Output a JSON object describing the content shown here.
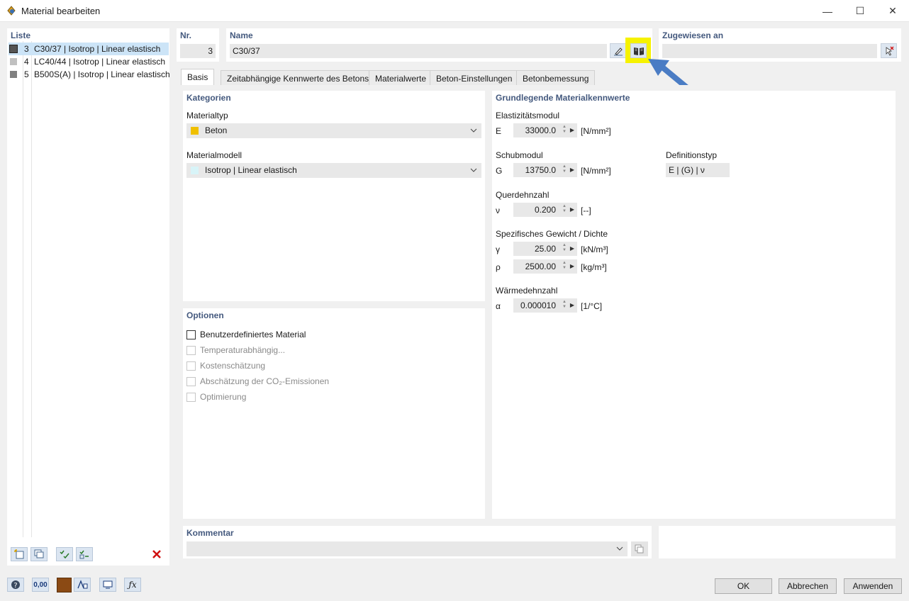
{
  "window": {
    "title": "Material bearbeiten",
    "minimize": "—",
    "maximize": "☐",
    "close": "✕"
  },
  "list": {
    "header": "Liste",
    "items": [
      {
        "no": "3",
        "label": "C30/37 | Isotrop | Linear elastisch",
        "color": "#555555"
      },
      {
        "no": "4",
        "label": "LC40/44 | Isotrop | Linear elastisch",
        "color": "#c0c0c0"
      },
      {
        "no": "5",
        "label": "B500S(A) | Isotrop | Linear elastisch",
        "color": "#808080"
      }
    ]
  },
  "header": {
    "nr_label": "Nr.",
    "nr_value": "3",
    "name_label": "Name",
    "name_value": "C30/37",
    "assigned_label": "Zugewiesen an",
    "assigned_value": ""
  },
  "tabs": [
    "Basis",
    "Zeitabhängige Kennwerte des Betons",
    "Materialwerte",
    "Beton-Einstellungen",
    "Betonbemessung"
  ],
  "categories": {
    "title": "Kategorien",
    "material_type_label": "Materialtyp",
    "material_type_value": "Beton",
    "material_type_color": "#f0c000",
    "material_model_label": "Materialmodell",
    "material_model_value": "Isotrop | Linear elastisch",
    "material_model_color": "#d8f4f8"
  },
  "options": {
    "title": "Optionen",
    "items": [
      {
        "label": "Benutzerdefiniertes Material",
        "enabled": true
      },
      {
        "label": "Temperaturabhängig...",
        "enabled": false
      },
      {
        "label": "Kostenschätzung",
        "enabled": false
      },
      {
        "label": "Abschätzung der CO₂-Emissionen",
        "enabled": false
      },
      {
        "label": "Optimierung",
        "enabled": false
      }
    ]
  },
  "basic_values": {
    "title": "Grundlegende Materialkennwerte",
    "e_modulus": {
      "label": "Elastizitätsmodul",
      "symbol": "E",
      "value": "33000.0",
      "unit": "[N/mm²]"
    },
    "shear_modulus": {
      "label": "Schubmodul",
      "symbol": "G",
      "value": "13750.0",
      "unit": "[N/mm²]"
    },
    "definition_type": {
      "label": "Definitionstyp",
      "value": "E | (G) | ν"
    },
    "poisson": {
      "label": "Querdehnzahl",
      "symbol": "ν",
      "value": "0.200",
      "unit": "[--]"
    },
    "weight_density": {
      "label": "Spezifisches Gewicht / Dichte"
    },
    "gamma": {
      "symbol": "γ",
      "value": "25.00",
      "unit": "[kN/m³]"
    },
    "rho": {
      "symbol": "ρ",
      "value": "2500.00",
      "unit": "[kg/m³]"
    },
    "thermal": {
      "label": "Wärmedehnzahl",
      "symbol": "α",
      "value": "0.000010",
      "unit": "[1/°C]"
    }
  },
  "comment": {
    "label": "Kommentar",
    "value": ""
  },
  "buttons": {
    "ok": "OK",
    "cancel": "Abbrechen",
    "apply": "Anwenden"
  },
  "bottom_tools": {
    "decimal_label": "0,00"
  },
  "colors": {
    "accent": "#44597e",
    "highlight": "#f6f200",
    "arrow": "#4a7cc4",
    "material_color": "#8b4a14"
  }
}
